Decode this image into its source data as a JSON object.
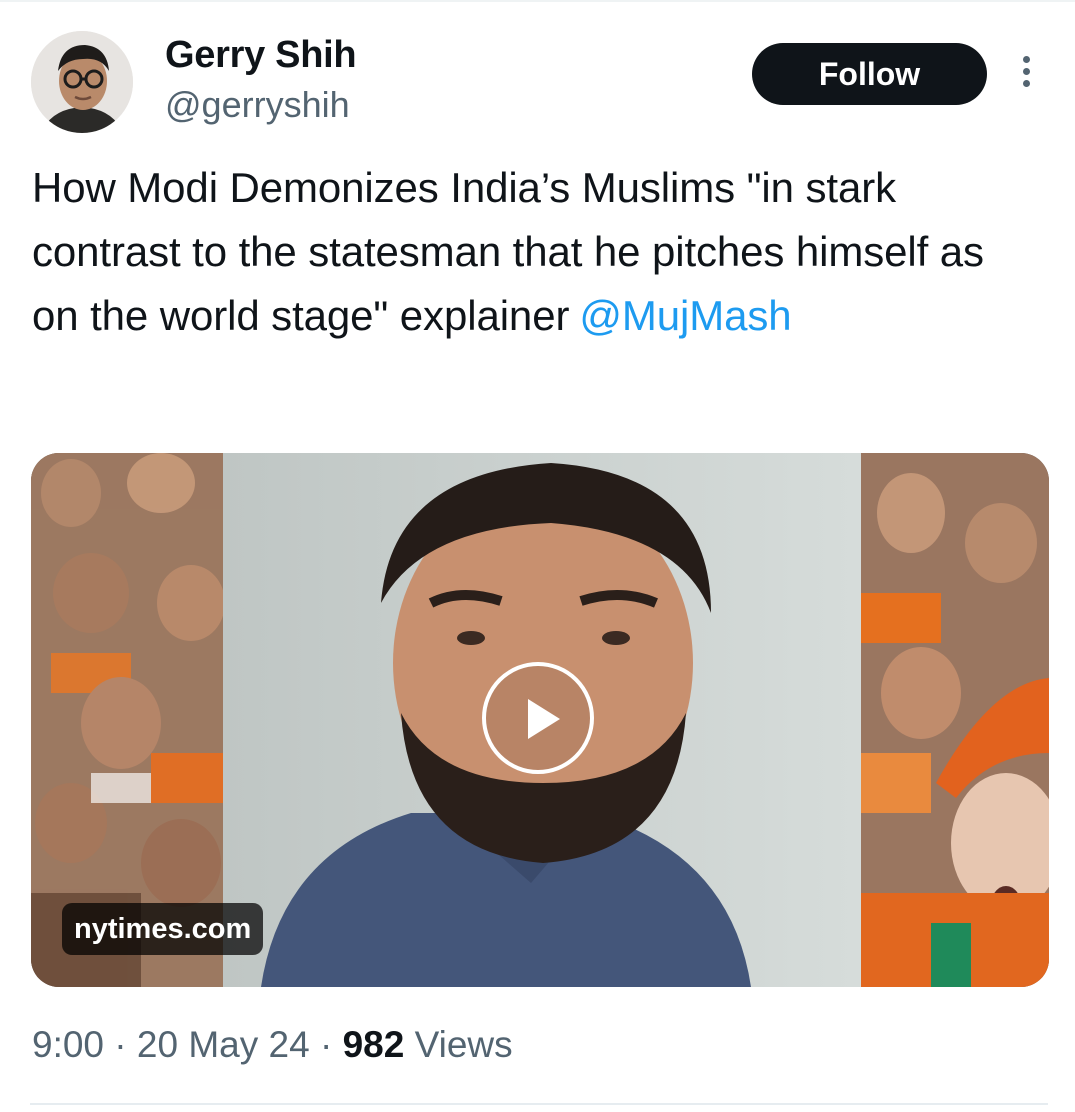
{
  "author": {
    "name": "Gerry Shih",
    "handle": "@gerryshih"
  },
  "follow_button": {
    "label": "Follow"
  },
  "tweet": {
    "text_main": "How Modi Demonizes India’s Muslims \"in stark contrast to the statesman that he pitches himself as on the world stage\" explainer",
    "mention": "@MujMash"
  },
  "media": {
    "source": "nytimes.com"
  },
  "meta": {
    "time": "9:00",
    "sep1": " · ",
    "date": "20 May 24",
    "sep2": " · ",
    "views_count": "982",
    "views_label": "Views"
  },
  "colors": {
    "mention": "#1d9bf0",
    "secondary_text": "#536471",
    "button_bg": "#0f1419"
  },
  "icons": [
    "more-options-icon",
    "play-icon"
  ]
}
